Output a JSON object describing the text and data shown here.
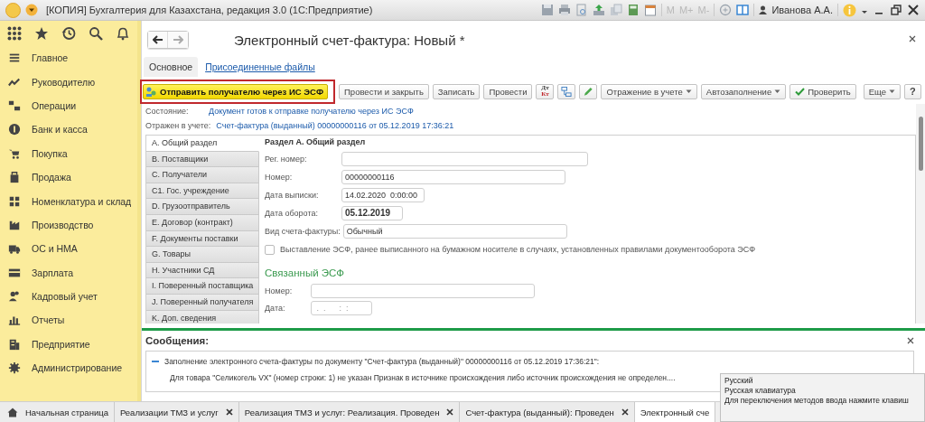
{
  "window": {
    "title": "[КОПИЯ] Бухгалтерия для Казахстана, редакция 3.0  (1С:Предприятие)",
    "memory_buttons": [
      "M",
      "M+",
      "M-"
    ],
    "user": "Иванова А.А."
  },
  "sidebar": {
    "items": [
      {
        "label": "Главное",
        "selected": false
      },
      {
        "label": "Руководителю",
        "selected": false
      },
      {
        "label": "Операции",
        "selected": false
      },
      {
        "label": "Банк и касса",
        "selected": false
      },
      {
        "label": "Покупка",
        "selected": false
      },
      {
        "label": "Продажа",
        "selected": false
      },
      {
        "label": "Номенклатура и склад",
        "selected": false
      },
      {
        "label": "Производство",
        "selected": false
      },
      {
        "label": "ОС и НМА",
        "selected": false
      },
      {
        "label": "Зарплата",
        "selected": false
      },
      {
        "label": "Кадровый учет",
        "selected": false
      },
      {
        "label": "Отчеты",
        "selected": false
      },
      {
        "label": "Предприятие",
        "selected": false
      },
      {
        "label": "Администрирование",
        "selected": false
      }
    ]
  },
  "form": {
    "title": "Электронный счет-фактура: Новый *",
    "tabs": [
      {
        "label": "Основное",
        "selected": true
      },
      {
        "label": "Присоединенные файлы",
        "selected": false
      }
    ],
    "toolbar": [
      {
        "kind": "send",
        "label": "Отправить получателю через ИС ЭСФ",
        "highlighted": true
      },
      {
        "kind": "text",
        "label": "Провести и закрыть"
      },
      {
        "kind": "text",
        "label": "Записать"
      },
      {
        "kind": "text",
        "label": "Провести"
      },
      {
        "kind": "dtkt",
        "top": "Дт",
        "bottom": "Кт"
      },
      {
        "kind": "structure"
      },
      {
        "kind": "edit"
      },
      {
        "kind": "dropdown",
        "label": "Отражение в учете"
      },
      {
        "kind": "dropdown",
        "label": "Автозаполнение"
      },
      {
        "kind": "check",
        "label": "Проверить"
      }
    ],
    "toolbar_right": [
      {
        "kind": "dropdown",
        "label": "Еще"
      },
      {
        "kind": "help",
        "label": "?"
      }
    ],
    "status": [
      {
        "label": "Состояние:",
        "value": "Документ готов к отправке получателю через ИС ЭСФ"
      },
      {
        "label": "Отражен в учете:",
        "value": "Счет-фактура (выданный) 00000000116 от 05.12.2019 17:36:21"
      }
    ],
    "sections": [
      {
        "label": "A. Общий раздел",
        "selected": true
      },
      {
        "label": "B. Поставщики",
        "selected": false
      },
      {
        "label": "C. Получатели",
        "selected": false
      },
      {
        "label": "C1. Гос. учреждение",
        "selected": false
      },
      {
        "label": "D. Грузоотправитель",
        "selected": false
      },
      {
        "label": "E. Договор (контракт)",
        "selected": false
      },
      {
        "label": "F. Документы поставки",
        "selected": false
      },
      {
        "label": "G. Товары",
        "selected": false
      },
      {
        "label": "H. Участники СД",
        "selected": false
      },
      {
        "label": "I. Поверенный поставщика",
        "selected": false
      },
      {
        "label": "J. Поверенный получателя",
        "selected": false
      },
      {
        "label": "K. Доп. сведения",
        "selected": false
      }
    ],
    "section_title": "Раздел A. Общий раздел",
    "fields": [
      {
        "label": "Рег. номер:"
      },
      {
        "label": "Номер:",
        "value": "00000000116",
        "bold": false
      },
      {
        "label": "Дата выписки:",
        "value": "14.02.2020  0:00:00",
        "bold": false
      },
      {
        "label": "Дата оборота:",
        "value": "05.12.2019",
        "bold": true
      },
      {
        "label": "Вид счета-фактуры:",
        "value": "Обычный",
        "bold": false
      }
    ],
    "paper_checkbox": {
      "label": "Выставление ЭСФ, ранее выписанного на бумажном носителе в случаях, установленных правилами документооборота ЭСФ",
      "checked": false
    },
    "related": {
      "title": "Связанный ЭСФ",
      "fields": [
        {
          "label": "Номер:"
        },
        {
          "label": "Дата:",
          "placeholder": " .  .      :  :"
        }
      ]
    }
  },
  "messages": {
    "title": "Сообщения:",
    "lines": [
      {
        "kind": "header",
        "text": "Заполнение электронного счета-фактуры по документу \"Счет-фактура (выданный)\" 00000000116 от 05.12.2019 17:36:21\":"
      },
      {
        "kind": "detail",
        "text": "Для товара \"Селикогель VX\" (номер строки: 1) не указан Признак в источнике происхождения либо источник происхождения не определен...."
      }
    ]
  },
  "taskbar": {
    "home": "Начальная страница",
    "tabs": [
      {
        "label": "Реализации ТМЗ и услуг",
        "selected": false
      },
      {
        "label": "Реализация ТМЗ и услуг: Реализация. Проведен",
        "selected": false
      },
      {
        "label": "Счет-фактура (выданный): Проведен",
        "selected": false
      },
      {
        "label": "Электронный сче",
        "selected": true
      }
    ]
  },
  "ime_popup": {
    "lines": [
      "Русский",
      "Русская клавиатура",
      "Для переключения методов ввода нажмите клавиш"
    ]
  }
}
